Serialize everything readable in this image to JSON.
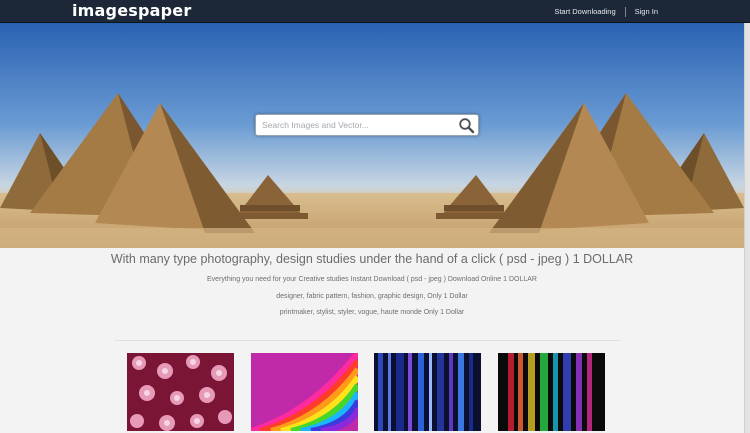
{
  "brand": {
    "logo": "imagespaper"
  },
  "topnav": {
    "start_downloading": "Start Downloading",
    "sign_in": "Sign In"
  },
  "search": {
    "placeholder": "Search Images and Vector..."
  },
  "intro": {
    "headline": "With many type photography, design studies under the hand of a click ( psd - jpeg ) 1 DOLLAR",
    "lines": [
      "Everything you need for your Creative studies Instant Download ( psd - jpeg ) Download Online 1 DOLLAR",
      "designer,  fabric pattern, fashion, graphic design, Only 1 Dollar",
      "printmaker, stylist, styler, vogue, haute monde Only 1 Dollar"
    ]
  },
  "thumbnails": [
    {
      "name": "pink floral pattern"
    },
    {
      "name": "rainbow curves"
    },
    {
      "name": "blue vertical stripes"
    },
    {
      "name": "color spectrum bars"
    }
  ],
  "colors": {
    "topbar": "#1c2838",
    "sky": "#3f78c0",
    "sand": "#c9a978",
    "page_bg": "#f3f3f3"
  }
}
